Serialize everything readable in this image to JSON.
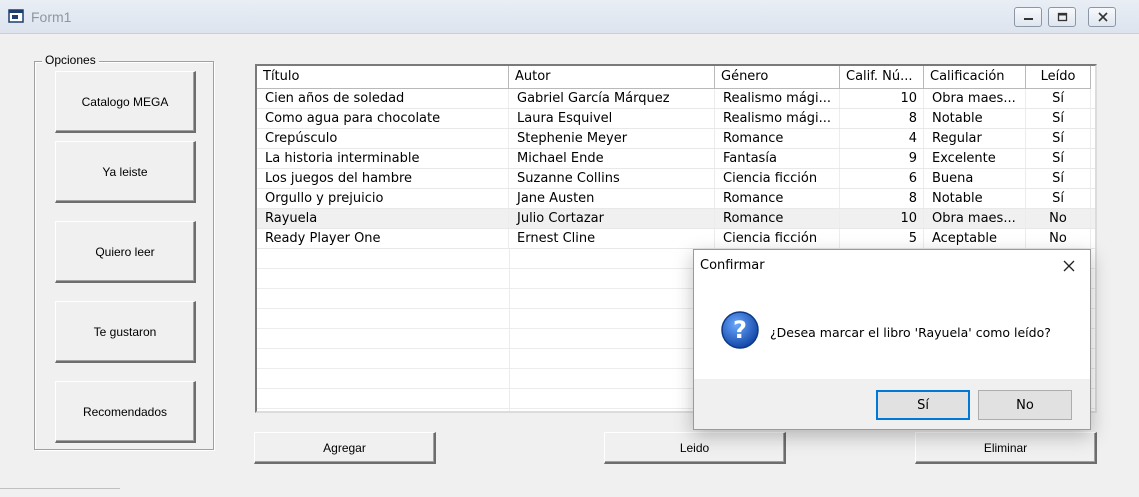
{
  "window": {
    "title": "Form1",
    "icon": "form-icon"
  },
  "options": {
    "caption": "Opciones",
    "buttons": [
      "Catalogo MEGA",
      "Ya leiste",
      "Quiero leer",
      "Te gustaron",
      "Recomendados"
    ]
  },
  "list": {
    "columns": [
      "Título",
      "Autor",
      "Género",
      "Calif. Nú...",
      "Calificación",
      "Leído"
    ],
    "rows": [
      [
        "Cien años de soledad",
        "Gabriel García Márquez",
        "Realismo mági...",
        "10",
        "Obra maes...",
        "Sí"
      ],
      [
        "Como agua para chocolate",
        "Laura Esquivel",
        "Realismo mági...",
        "8",
        "Notable",
        "Sí"
      ],
      [
        "Crepúsculo",
        "Stephenie Meyer",
        "Romance",
        "4",
        "Regular",
        "Sí"
      ],
      [
        "La historia interminable",
        "Michael Ende",
        "Fantasía",
        "9",
        "Excelente",
        "Sí"
      ],
      [
        "Los juegos del hambre",
        "Suzanne Collins",
        "Ciencia ficción",
        "6",
        "Buena",
        "Sí"
      ],
      [
        "Orgullo y prejuicio",
        "Jane Austen",
        "Romance",
        "8",
        "Notable",
        "Sí"
      ],
      [
        "Rayuela",
        "Julio Cortazar",
        "Romance",
        "10",
        "Obra maes...",
        "No"
      ],
      [
        "Ready Player One",
        "Ernest Cline",
        "Ciencia ficción",
        "5",
        "Aceptable",
        "No"
      ]
    ]
  },
  "actions": {
    "agregar": "Agregar",
    "leido": "Leido",
    "eliminar": "Eliminar"
  },
  "dialog": {
    "title": "Confirmar",
    "message": "¿Desea marcar el libro 'Rayuela' como leído?",
    "yes": "Sí",
    "no": "No",
    "icon": "question-icon"
  }
}
